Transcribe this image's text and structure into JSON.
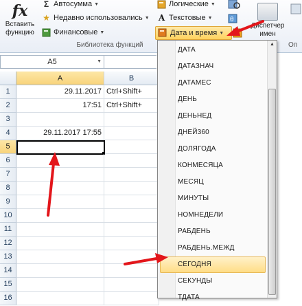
{
  "ribbon": {
    "insert_function": {
      "symbol": "fx",
      "line1": "Вставить",
      "line2": "функцию"
    },
    "autosum": {
      "label": "Автосумма",
      "icon": "sigma-icon"
    },
    "recent": {
      "label": "Недавно использовались",
      "icon": "star-icon"
    },
    "financial": {
      "label": "Финансовые",
      "icon": "book-icon"
    },
    "logical": {
      "label": "Логические",
      "icon": "book-icon"
    },
    "text": {
      "label": "Текстовые",
      "icon": "text-a-icon"
    },
    "datetime": {
      "label": "Дата и время",
      "icon": "calendar-book-icon"
    },
    "library_label": "Библиотека функций",
    "dispatcher": {
      "line1": "Диспетчер",
      "line2": "имен"
    },
    "right_label": "Оп"
  },
  "formula_bar": {
    "name_box": "A5"
  },
  "sheet": {
    "columns": [
      "A",
      "B"
    ],
    "rows": [
      "1",
      "2",
      "3",
      "4",
      "5",
      "6",
      "7",
      "8",
      "9",
      "10",
      "11",
      "12",
      "13",
      "14",
      "15",
      "16"
    ],
    "cells": {
      "A1": "29.11.2017",
      "B1": "Ctrl+Shift+",
      "A2": "17:51",
      "B2": "Ctrl+Shift+",
      "A4": "29.11.2017 17:55"
    },
    "selected_cell": "A5"
  },
  "menu": {
    "items": [
      "ДАТА",
      "ДАТАЗНАЧ",
      "ДАТАМЕС",
      "ДЕНЬ",
      "ДЕНЬНЕД",
      "ДНЕЙ360",
      "ДОЛЯГОДА",
      "КОНМЕСЯЦА",
      "МЕСЯЦ",
      "МИНУТЫ",
      "НОМНЕДЕЛИ",
      "РАБДЕНЬ",
      "РАБДЕНЬ.МЕЖД",
      "СЕГОДНЯ",
      "СЕКУНДЫ",
      "ТДАТА"
    ],
    "highlighted": "СЕГОДНЯ"
  },
  "colors": {
    "annotation_arrow": "#e3161b",
    "highlight": "#ffdd86",
    "header_active": "#f8d37b"
  }
}
